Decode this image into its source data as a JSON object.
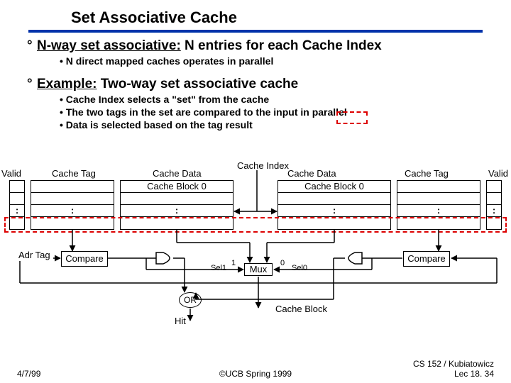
{
  "title": "Set Associative Cache",
  "bullets": {
    "b1_prefix": "N-way set associative:",
    "b1_rest": " N entries for each Cache Index",
    "b1s1": "N direct mapped caches operates in parallel",
    "b2_prefix": "Example:",
    "b2_rest": " Two-way set associative cache",
    "b2s1": "Cache Index selects a \"set\" from the cache",
    "b2s2": "The two tags in the set are compared to the input in parallel",
    "b2s3": "Data is selected based on the tag result"
  },
  "labels": {
    "valid_l": "Valid",
    "valid_r": "Valid",
    "ctag_l": "Cache Tag",
    "ctag_r": "Cache Tag",
    "cdata_l": "Cache Data",
    "cdata_r": "Cache Data",
    "cindex": "Cache Index",
    "cb0_l": "Cache Block 0",
    "cb0_r": "Cache Block 0",
    "adrtag": "Adr Tag",
    "compare_l": "Compare",
    "compare_r": "Compare",
    "sel1": "Sel1",
    "sel0": "Sel0",
    "one": "1",
    "zero": "0",
    "mux": "Mux",
    "or": "OR",
    "hit": "Hit",
    "cacheblock": "Cache Block",
    "vdots": ":"
  },
  "footer": {
    "date": "4/7/99",
    "center": "©UCB Spring 1999",
    "right1": "CS 152 / Kubiatowicz",
    "right2": "Lec 18. 34"
  }
}
